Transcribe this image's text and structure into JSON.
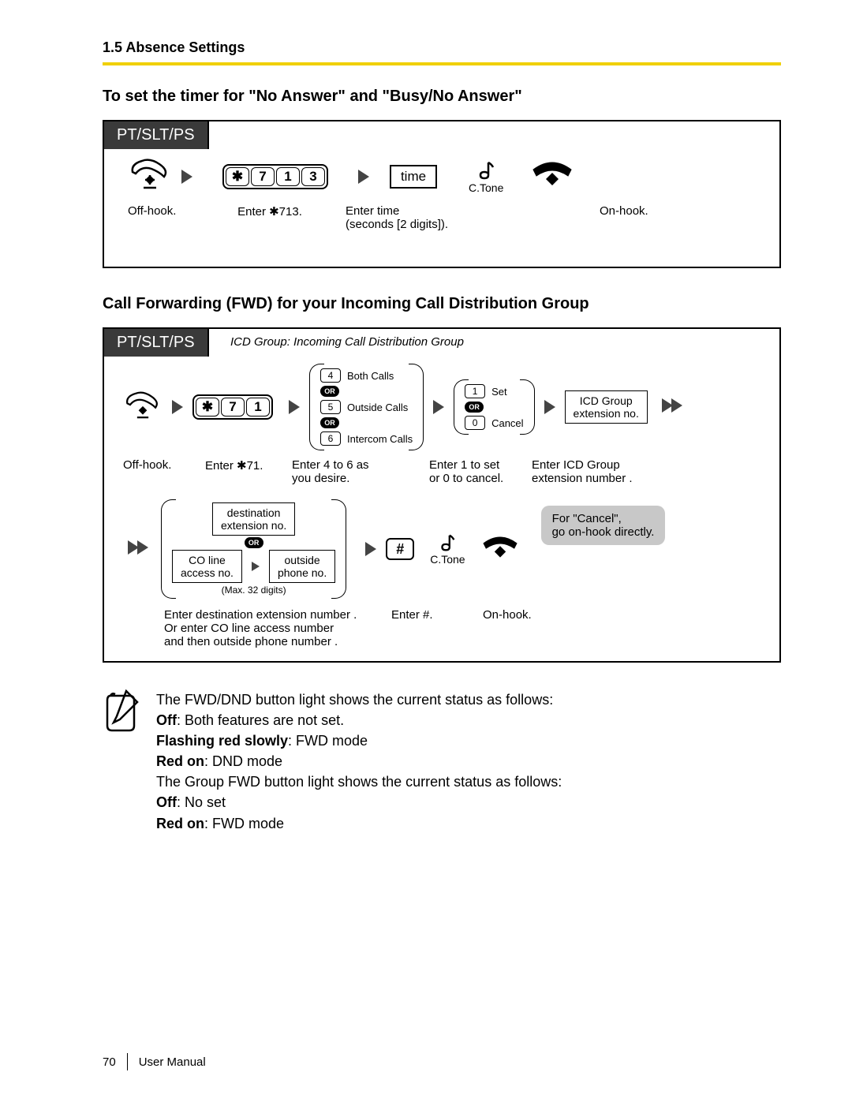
{
  "header": {
    "section": "1.5 Absence Settings"
  },
  "section1": {
    "heading": "To set the timer for \"No Answer\" and \"Busy/No Answer\"",
    "tab": "PT/SLT/PS",
    "keys": {
      "star": "✱",
      "d1": "7",
      "d2": "1",
      "d3": "3"
    },
    "timeField": "time",
    "ctone": "C.Tone",
    "captions": {
      "offhook": "Off-hook.",
      "enter713": "Enter ✱713.",
      "entertime1": "Enter time",
      "entertime2": "(seconds  [2 digits]).",
      "onhook": "On-hook."
    }
  },
  "section2": {
    "heading": "Call Forwarding (FWD) for your Incoming Call Distribution Group",
    "tab": "PT/SLT/PS",
    "tabNote": "ICD Group: Incoming Call Distribution Group",
    "keys": {
      "star": "✱",
      "d1": "7",
      "d2": "1",
      "hash": "#"
    },
    "optsA": {
      "o4": "4",
      "o4label": "Both Calls",
      "o5": "5",
      "o5label": "Outside Calls",
      "o6": "6",
      "o6label": "Intercom Calls",
      "or": "OR"
    },
    "optsB": {
      "o1": "1",
      "o1label": "Set",
      "o0": "0",
      "o0label": "Cancel",
      "or": "OR"
    },
    "icdBox1": "ICD Group",
    "icdBox2": "extension no.",
    "cancelNote1": "For \"Cancel\",",
    "cancelNote2": "go on-hook directly.",
    "destBox1": "destination",
    "destBox2": "extension no.",
    "coBox1": "CO line",
    "coBox2": "access no.",
    "outBox1": "outside",
    "outBox2": "phone no.",
    "maxNote": "(Max. 32 digits)",
    "ctone": "C.Tone",
    "captions": {
      "offhook": "Off-hook.",
      "enter71": "Enter ✱71.",
      "enter46a": "Enter 4 to 6 as",
      "enter46b": "you desire.",
      "enter10a": "Enter 1 to set",
      "enter10b": "or 0 to cancel.",
      "entericd1": "Enter ICD Group",
      "entericd2": "extension number   .",
      "dest1": "Enter destination extension number   .",
      "dest2": "Or enter CO line access number",
      "dest3": "and then outside phone number   .",
      "enterhash": "Enter #.",
      "onhook": "On-hook."
    }
  },
  "notes": {
    "l1": "The FWD/DND button light shows the current status as follows:",
    "l2a": "Off",
    "l2b": ": Both features are not set.",
    "l3a": "Flashing red slowly",
    "l3b": ": FWD mode",
    "l4a": "Red on",
    "l4b": ": DND mode",
    "l5": "The Group FWD button light shows the current status as follows:",
    "l6a": "Off",
    "l6b": ": No set",
    "l7a": "Red on",
    "l7b": ": FWD mode"
  },
  "footer": {
    "page": "70",
    "title": "User Manual"
  }
}
